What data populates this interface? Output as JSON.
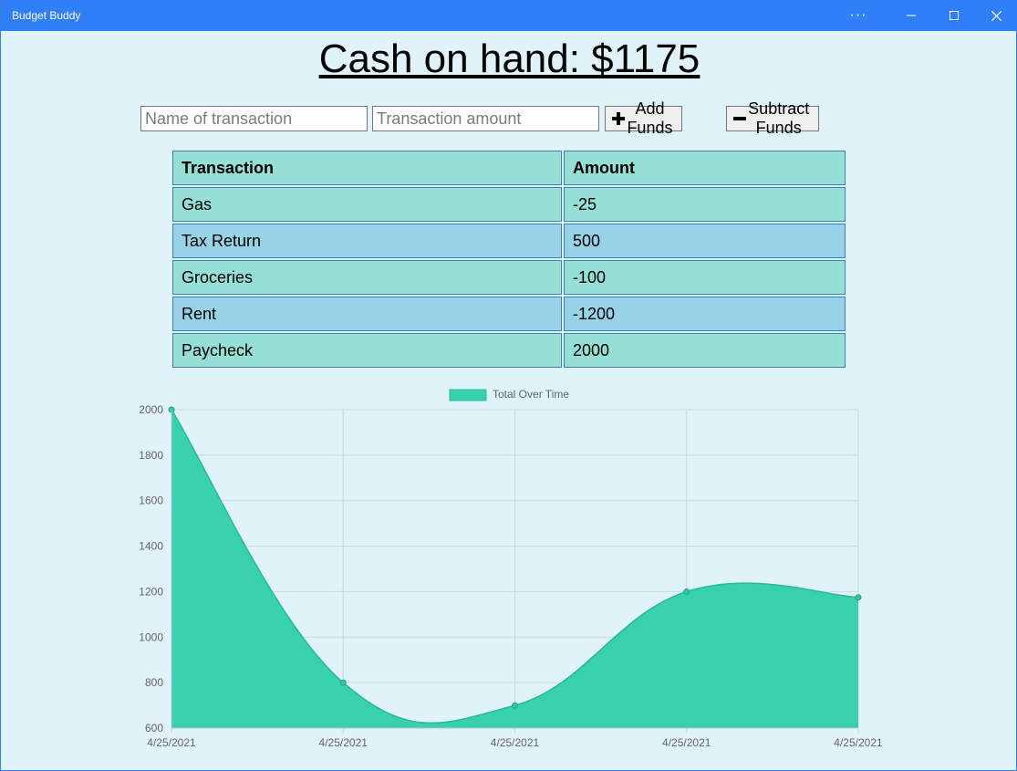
{
  "window": {
    "title": "Budget Buddy",
    "more_label": "···",
    "minimize_label": "—",
    "maximize_label": "☐",
    "close_label": "✕"
  },
  "header": {
    "cash_text": "Cash on hand: $1175"
  },
  "form": {
    "name_placeholder": "Name of transaction",
    "amount_placeholder": "Transaction amount",
    "add_label": "Add Funds",
    "subtract_label": "Subtract Funds",
    "add_icon": "plus-icon",
    "subtract_icon": "minus-icon"
  },
  "table": {
    "headers": [
      "Transaction",
      "Amount"
    ],
    "rows": [
      [
        "Gas",
        "-25"
      ],
      [
        "Tax Return",
        "500"
      ],
      [
        "Groceries",
        "-100"
      ],
      [
        "Rent",
        "-1200"
      ],
      [
        "Paycheck",
        "2000"
      ]
    ]
  },
  "colors": {
    "row_green": "#96dfd4",
    "row_blue": "#98d2e7",
    "chart_fill": "#37d1ae",
    "titlebar": "#2f7ff6"
  },
  "chart_data": {
    "type": "area",
    "legend": [
      "Total Over Time"
    ],
    "legend_position": "top",
    "x": [
      "4/25/2021",
      "4/25/2021",
      "4/25/2021",
      "4/25/2021",
      "4/25/2021"
    ],
    "series": [
      {
        "name": "Total Over Time",
        "values": [
          2000,
          800,
          700,
          1200,
          1175
        ]
      }
    ],
    "ylim": [
      600,
      2000
    ],
    "yticks": [
      600,
      800,
      1000,
      1200,
      1400,
      1600,
      1800,
      2000
    ],
    "grid": true
  }
}
